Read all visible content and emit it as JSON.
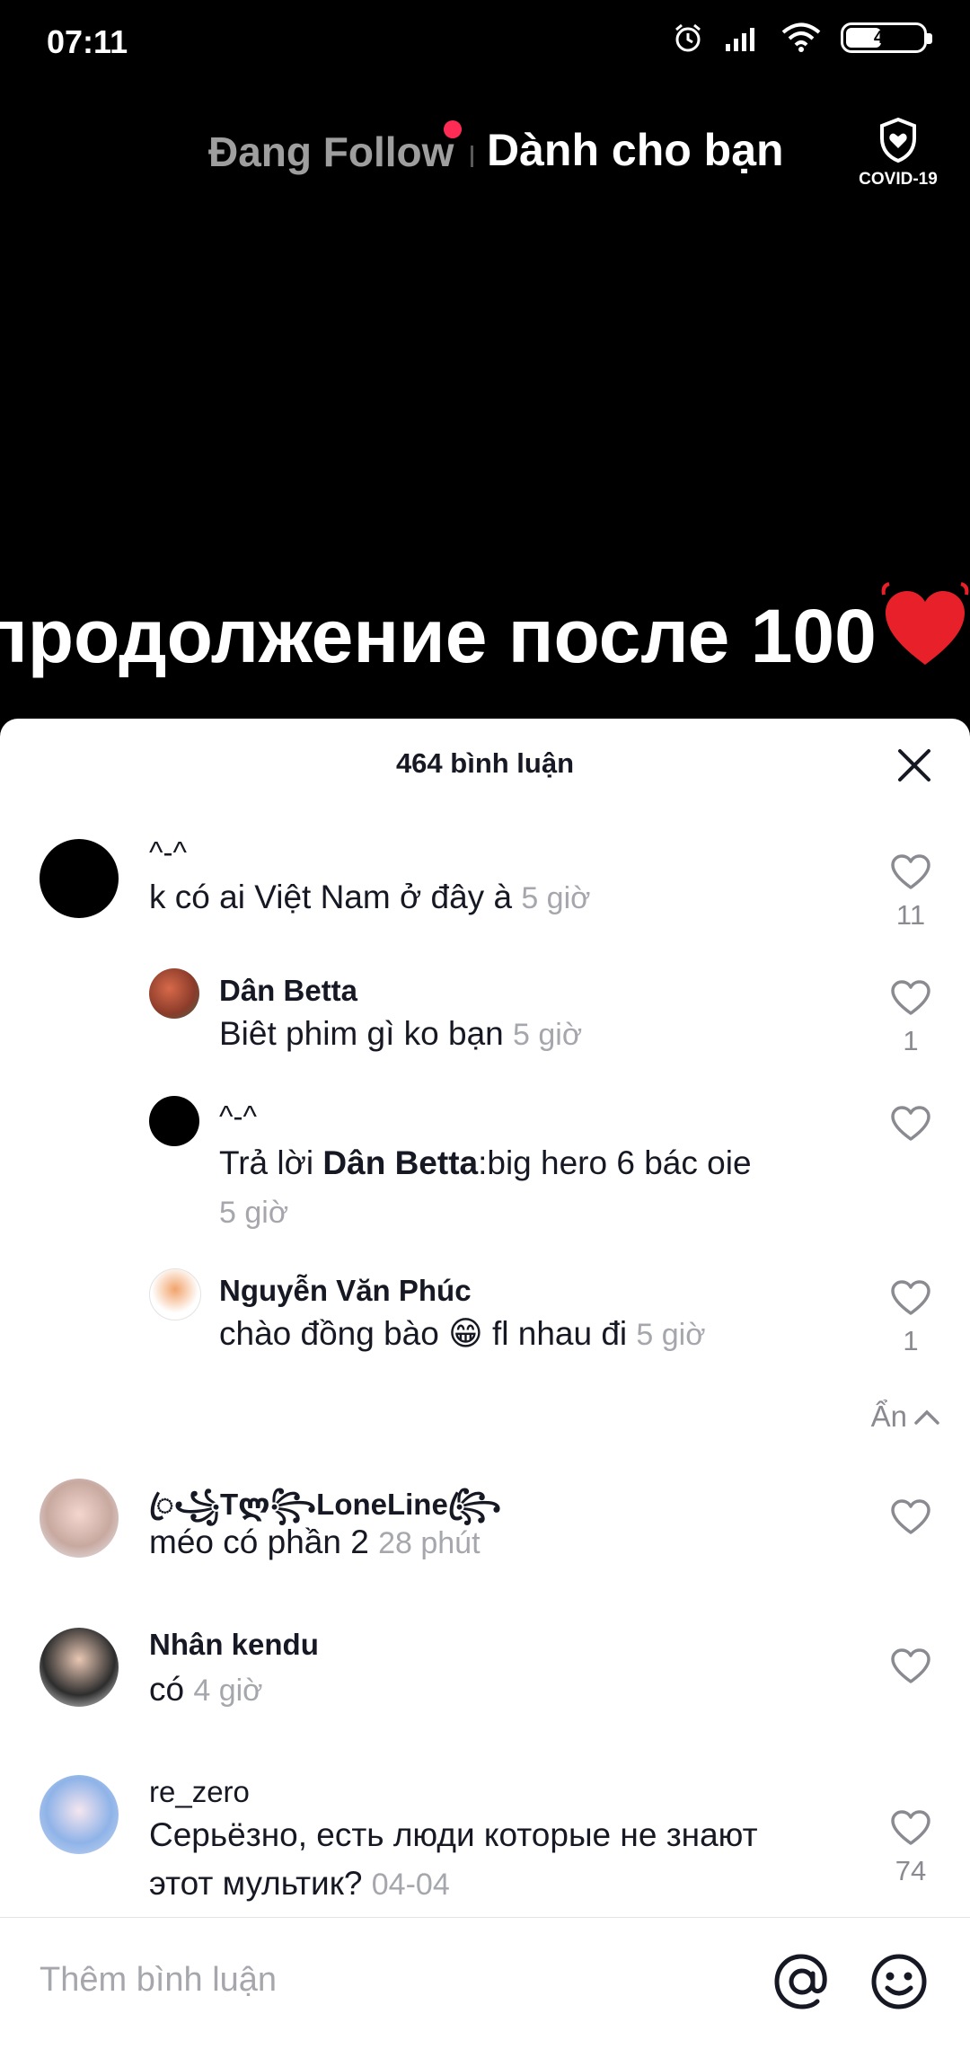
{
  "status_bar": {
    "time": "07:11",
    "battery": "47",
    "battery_level": 0.47
  },
  "top_nav": {
    "following": "Đang Follow",
    "for_you": "Dành cho bạn",
    "covid": "COVID-19"
  },
  "video": {
    "caption": "продолжение после 100"
  },
  "comments_panel": {
    "title": "464 bình luận",
    "collapse_label": "Ẩn",
    "comments": [
      {
        "name": "^-^",
        "text": "k có ai Việt Nam ở đây à",
        "time": "5 giờ",
        "likes": "11"
      },
      {
        "name": "Dân Betta",
        "text": "Biêt phim gì ko bạn",
        "time": "5 giờ",
        "likes": "1"
      },
      {
        "name": "^-^",
        "reply_prefix": "Trả lời ",
        "reply_to": "Dân Betta",
        "text": ":big hero 6 bác oie",
        "time": "5 giờ",
        "likes": ""
      },
      {
        "name": "Nguyễn Văn Phúc",
        "text": "chào đồng bào 😁 fl nhau đi",
        "time": "5 giờ",
        "likes": "1"
      },
      {
        "name": "ꦿ꧁Tლ꧂LoneLine꧂ꦿ",
        "text": "méo có phần 2",
        "time": "28 phút",
        "likes": ""
      },
      {
        "name": "Nhân kendu",
        "text": "có",
        "time": "4 giờ",
        "likes": ""
      },
      {
        "name": "re_zero",
        "text_line1": "Серьёзно, есть люди которые не знают",
        "text_line2": "этот мультик?",
        "time": "04-04",
        "likes": "74"
      }
    ]
  },
  "input": {
    "placeholder": "Thêm bình luận"
  },
  "colors": {
    "accent": "#fe2c55",
    "text_primary": "#161823",
    "text_secondary": "#a5a7ad"
  }
}
